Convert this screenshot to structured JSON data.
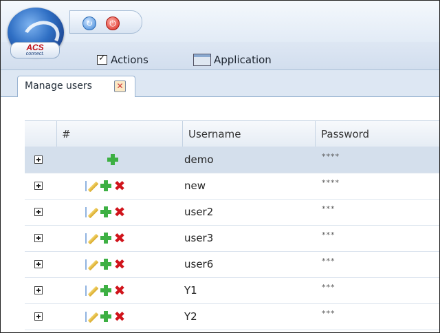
{
  "app": {
    "logo_text": "ACS",
    "logo_subtext": "connect."
  },
  "menu": {
    "actions": "Actions",
    "application": "Application"
  },
  "tabs": [
    {
      "label": "Manage users",
      "close_icon": "close-icon"
    }
  ],
  "grid": {
    "columns": [
      "#",
      "Username",
      "Password"
    ],
    "rows": [
      {
        "username": "demo",
        "password": "****",
        "actions": [
          "add"
        ]
      },
      {
        "username": "new",
        "password": "****",
        "actions": [
          "edit",
          "add",
          "delete"
        ]
      },
      {
        "username": "user2",
        "password": "***",
        "actions": [
          "edit",
          "add",
          "delete"
        ]
      },
      {
        "username": "user3",
        "password": "***",
        "actions": [
          "edit",
          "add",
          "delete"
        ]
      },
      {
        "username": "user6",
        "password": "***",
        "actions": [
          "edit",
          "add",
          "delete"
        ]
      },
      {
        "username": "Y1",
        "password": "***",
        "actions": [
          "edit",
          "add",
          "delete"
        ]
      },
      {
        "username": "Y2",
        "password": "***",
        "actions": [
          "edit",
          "add",
          "delete"
        ]
      }
    ]
  },
  "colors": {
    "selected_row": "#d4dfec",
    "add_icon": "#3db043",
    "delete_icon": "#d0141b"
  }
}
